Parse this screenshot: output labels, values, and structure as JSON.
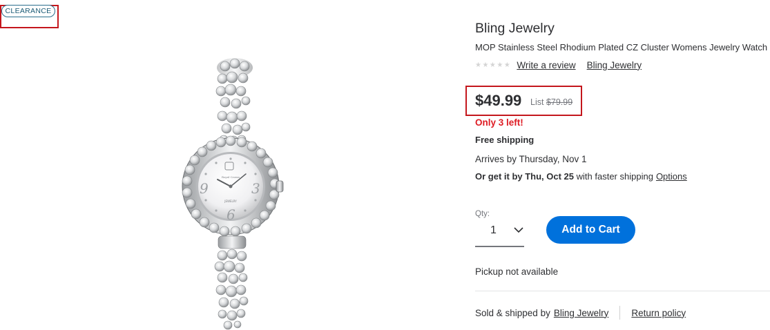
{
  "badge": {
    "clearance": "CLEARANCE"
  },
  "product": {
    "brand": "Bling Jewelry",
    "title": "MOP Stainless Steel Rhodium Plated CZ Cluster Womens Jewelry Watch",
    "rating_stars": "★★★★★",
    "rating_value": 0,
    "write_review": "Write a review",
    "brand_link": "Bling Jewelry",
    "image_icon": "watch-image",
    "dial_brand_text": "Royal Crown",
    "dial_label": "JEWELRY"
  },
  "pricing": {
    "price": "$49.99",
    "list_label": "List",
    "list_price": "$79.99",
    "stock": "Only 3 left!"
  },
  "shipping": {
    "free": "Free shipping",
    "arrives": "Arrives by Thursday, Nov 1",
    "faster_bold": "Or get it by Thu, Oct 25",
    "faster_text": " with faster shipping",
    "options": "Options"
  },
  "purchase": {
    "qty_label": "Qty:",
    "qty_value": "1",
    "add_to_cart": "Add to Cart",
    "pickup": "Pickup not available"
  },
  "seller": {
    "sold_label": "Sold & shipped by",
    "seller_name": "Bling Jewelry",
    "return_policy": "Return policy"
  },
  "colors": {
    "accent_blue": "#0071dc",
    "stock_red": "#de1c24",
    "highlight_red": "#c4161c"
  }
}
